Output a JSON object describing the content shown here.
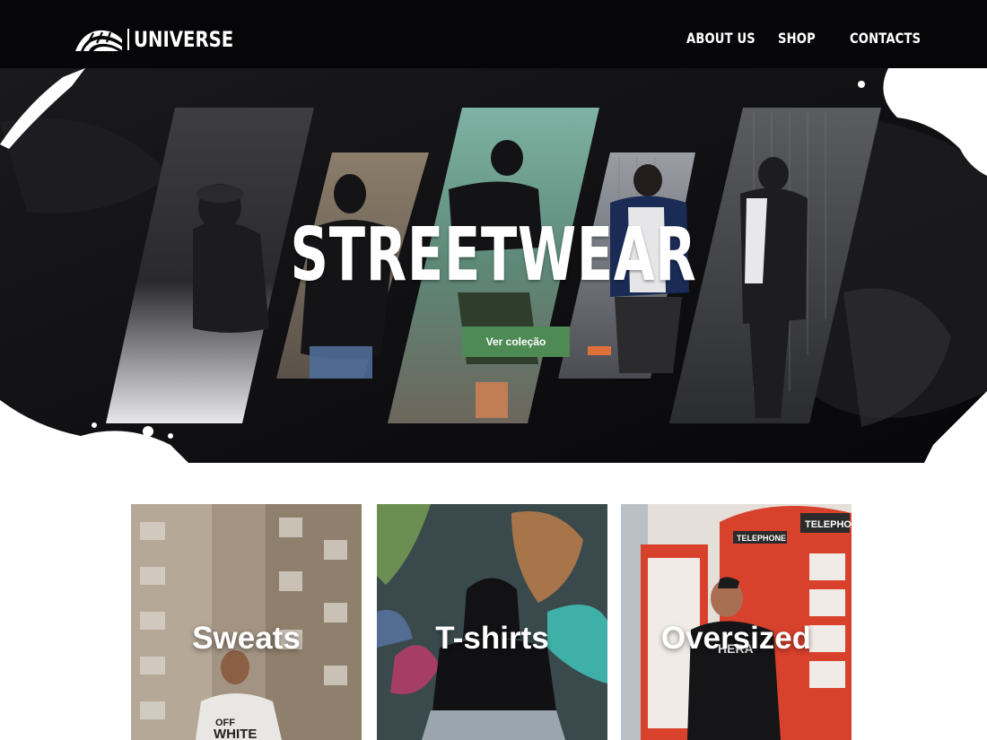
{
  "brand": {
    "name": "UNIVERSE",
    "logo_icon": "zebra-stripes-logo"
  },
  "nav": {
    "items": [
      {
        "label": "ABOUT US"
      },
      {
        "label": "SHOP"
      },
      {
        "label": "CONTACTS"
      }
    ]
  },
  "hero": {
    "title": "STREETWEAR",
    "button_label": "Ver coleção"
  },
  "categories": [
    {
      "label": "Sweats",
      "shirt_text": "OFF WHITE"
    },
    {
      "label": "T-shirts"
    },
    {
      "label": "Oversized",
      "phone_booth_sign": "TELEPHONE",
      "shirt_text": "HERA"
    }
  ],
  "colors": {
    "navbar_bg": "#060608",
    "hero_bg": "#0a090c",
    "accent_button": "#4e8a54",
    "text_light": "#ffffff",
    "phone_booth_red": "#d8412c"
  }
}
